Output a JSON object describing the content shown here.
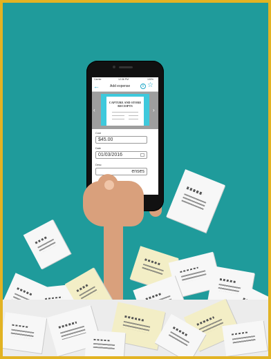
{
  "colors": {
    "background": "#1f9b9b",
    "border": "#e2b323",
    "accent": "#1aa6c7",
    "skin": "#d9a07c",
    "receipt_white": "#f7f7f7",
    "receipt_cream": "#f3eec6"
  },
  "phone": {
    "status_bar": {
      "carrier": "Carrier",
      "time": "12:36 PM",
      "battery": "100%"
    },
    "nav": {
      "title": "Add expense",
      "back_icon": "back-arrow-icon",
      "info_icon": "info-icon",
      "star_icon": "star-icon"
    },
    "carousel": {
      "card_title": "CAPTURE AND STORE RECEIPTS",
      "active_slide": 2,
      "slide_count": 3
    },
    "form": {
      "cost_label": "Cost",
      "cost_value": "$45.00",
      "date_label": "Date",
      "date_value": "01/03/2016",
      "description_label": "Desc",
      "description_value": "enses"
    }
  }
}
